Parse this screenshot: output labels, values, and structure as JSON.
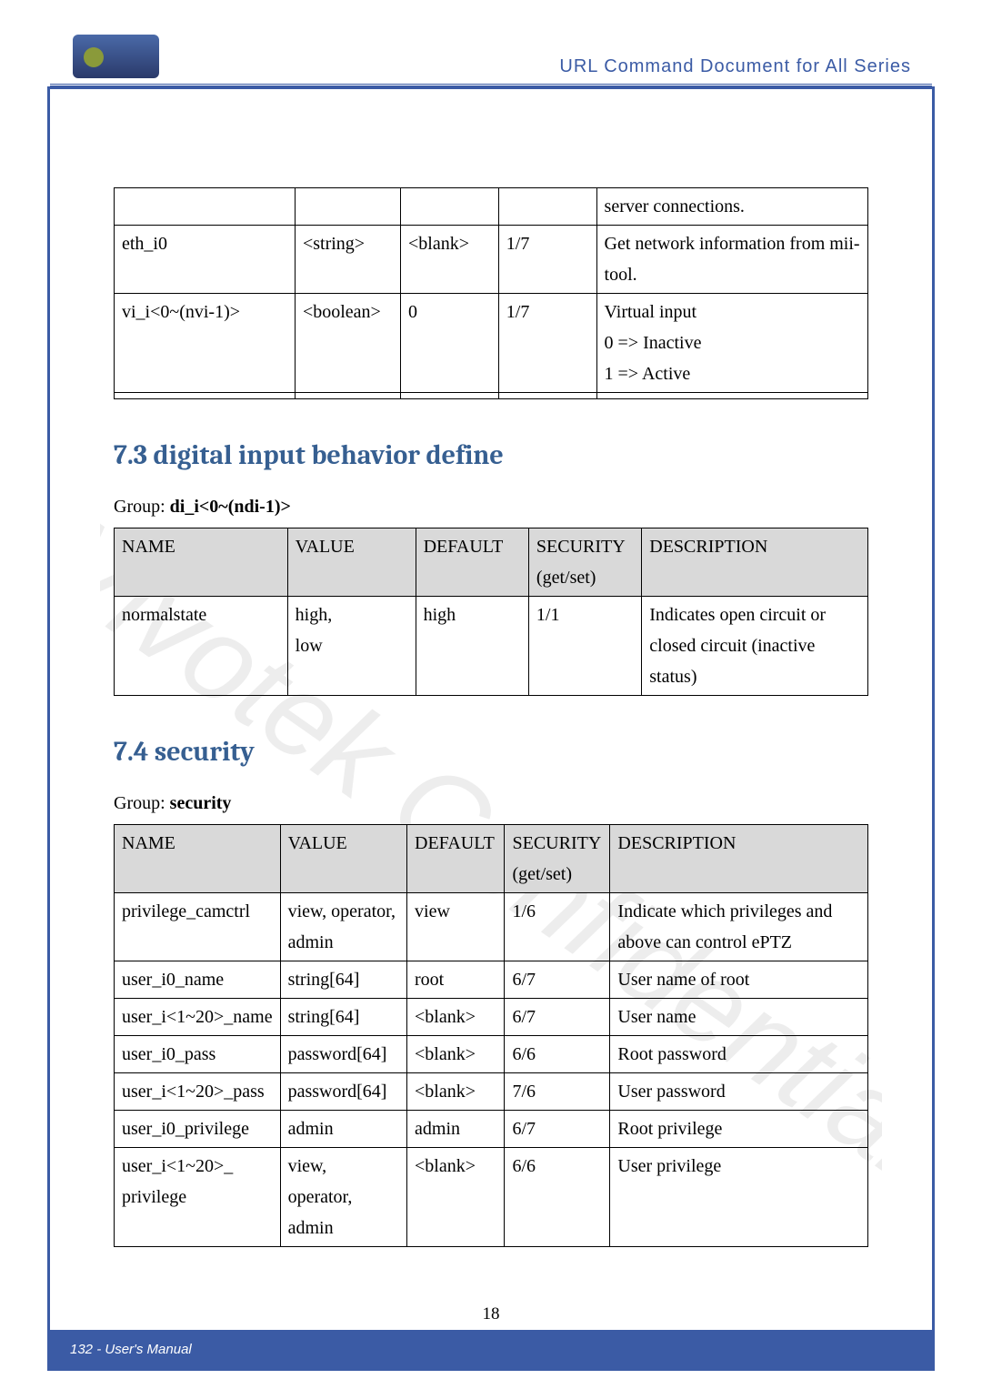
{
  "header": {
    "doc_title": "URL Command Document for All Series"
  },
  "watermark": "Vivotek Confidential",
  "table1": {
    "rows": [
      {
        "name": "",
        "value": "",
        "default": "",
        "security": "",
        "desc": "server connections."
      },
      {
        "name": "eth_i0",
        "value": "<string>",
        "default": "<blank>",
        "security": "1/7",
        "desc": "Get network information from mii-tool."
      },
      {
        "name": "vi_i<0~(nvi-1)>",
        "value": "<boolean>",
        "default": "0",
        "security": "1/7",
        "desc": "Virtual input\n0 => Inactive\n1 => Active"
      },
      {
        "name": "",
        "value": "",
        "default": "",
        "security": "",
        "desc": ""
      }
    ]
  },
  "section73": {
    "heading": "7.3 digital input behavior define",
    "group_label": "Group: ",
    "group_value": "di_i<0~(ndi-1)>",
    "headers": [
      "NAME",
      "VALUE",
      "DEFAULT",
      "SECURITY (get/set)",
      "DESCRIPTION"
    ],
    "rows": [
      {
        "name": "normalstate",
        "value": "high,\nlow",
        "default": "high",
        "security": "1/1",
        "desc": "Indicates open circuit or closed circuit (inactive status)"
      }
    ]
  },
  "section74": {
    "heading": "7.4 security",
    "group_label": "Group: ",
    "group_value": "security",
    "headers": [
      "NAME",
      "VALUE",
      "DEFAULT",
      "SECURITY (get/set)",
      "DESCRIPTION"
    ],
    "rows": [
      {
        "name": "privilege_camctrl",
        "value": "view, operator, admin",
        "default": "view",
        "security": "1/6",
        "desc": "Indicate which privileges and above can control ePTZ"
      },
      {
        "name": "user_i0_name",
        "value": "string[64]",
        "default": "root",
        "security": "6/7",
        "desc": "User name of root"
      },
      {
        "name": "user_i<1~20>_name",
        "value": "string[64]",
        "default": "<blank>",
        "security": "6/7",
        "desc": "User name"
      },
      {
        "name": "user_i0_pass",
        "value": "password[64]",
        "default": "<blank>",
        "security": "6/6",
        "desc": "Root password"
      },
      {
        "name": "user_i<1~20>_pass",
        "value": "password[64]",
        "default": "<blank>",
        "security": "7/6",
        "desc": "User password"
      },
      {
        "name": "user_i0_privilege",
        "value": "admin",
        "default": "admin",
        "security": "6/7",
        "desc": "Root privilege"
      },
      {
        "name": "user_i<1~20>_ privilege",
        "value": "view,\noperator,\nadmin",
        "default": "<blank>",
        "security": "6/6",
        "desc": "User privilege"
      }
    ]
  },
  "footer": {
    "left": "132 - User's Manual",
    "page": "18"
  }
}
